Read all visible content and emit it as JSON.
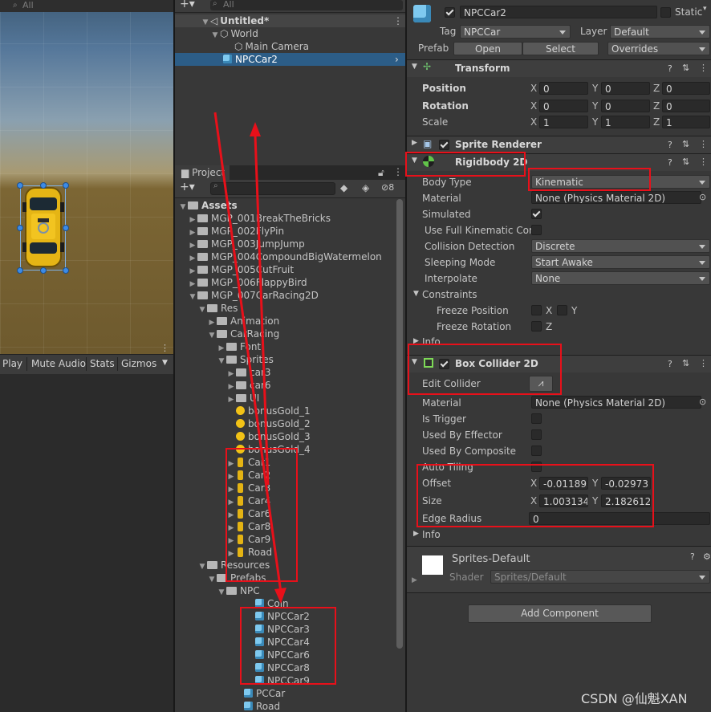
{
  "scene": {
    "search_placeholder": "All"
  },
  "game_toolbar": {
    "play": "Play",
    "mute_audio": "Mute Audio",
    "stats": "Stats",
    "gizmos": "Gizmos"
  },
  "hierarchy": {
    "search_placeholder": "All",
    "items": [
      {
        "label": "Untitled*"
      },
      {
        "label": "World"
      },
      {
        "label": "Main Camera"
      },
      {
        "label": "NPCCar2"
      }
    ]
  },
  "project": {
    "tab": "Project",
    "hidden_count": "8",
    "tree": [
      {
        "label": "Assets"
      },
      {
        "label": "MGP_001BreakTheBricks"
      },
      {
        "label": "MGP_002FlyPin"
      },
      {
        "label": "MGP_003JumpJump"
      },
      {
        "label": "MGP_004CompoundBigWatermelon"
      },
      {
        "label": "MGP_005CutFruit"
      },
      {
        "label": "MGP_006FlappyBird"
      },
      {
        "label": "MGP_007CarRacing2D"
      },
      {
        "label": "Res"
      },
      {
        "label": "Animation"
      },
      {
        "label": "CarRacing"
      },
      {
        "label": "Font"
      },
      {
        "label": "Sprites"
      },
      {
        "label": "car3"
      },
      {
        "label": "car6"
      },
      {
        "label": "UI"
      },
      {
        "label": "bonusGold_1"
      },
      {
        "label": "bonusGold_2"
      },
      {
        "label": "bonusGold_3"
      },
      {
        "label": "bonusGold_4"
      },
      {
        "label": "Car1"
      },
      {
        "label": "Car2"
      },
      {
        "label": "Car3"
      },
      {
        "label": "Car4"
      },
      {
        "label": "Car6"
      },
      {
        "label": "Car8"
      },
      {
        "label": "Car9"
      },
      {
        "label": "Road"
      },
      {
        "label": "Resources"
      },
      {
        "label": "Prefabs"
      },
      {
        "label": "NPC"
      },
      {
        "label": "Coin"
      },
      {
        "label": "NPCCar2"
      },
      {
        "label": "NPCCar3"
      },
      {
        "label": "NPCCar4"
      },
      {
        "label": "NPCCar6"
      },
      {
        "label": "NPCCar8"
      },
      {
        "label": "NPCCar9"
      },
      {
        "label": "PCCar"
      },
      {
        "label": "Road"
      }
    ]
  },
  "inspector": {
    "object_name": "NPCCar2",
    "static_label": "Static",
    "tag_label": "Tag",
    "tag_value": "NPCCar",
    "layer_label": "Layer",
    "layer_value": "Default",
    "prefab_label": "Prefab",
    "open": "Open",
    "select": "Select",
    "overrides": "Overrides",
    "transform": {
      "title": "Transform",
      "position_label": "Position",
      "rotation_label": "Rotation",
      "scale_label": "Scale",
      "x": "X",
      "y": "Y",
      "z": "Z",
      "position": [
        "0",
        "0",
        "0"
      ],
      "rotation": [
        "0",
        "0",
        "0"
      ],
      "scale": [
        "1",
        "1",
        "1"
      ]
    },
    "sprite_renderer": {
      "title": "Sprite Renderer"
    },
    "rigidbody": {
      "title": "Rigidbody 2D",
      "body_type_label": "Body Type",
      "body_type": "Kinematic",
      "material_label": "Material",
      "material": "None (Physics Material 2D)",
      "simulated_label": "Simulated",
      "full_kinematic_label": "Use Full Kinematic Cont",
      "collision_label": "Collision Detection",
      "collision": "Discrete",
      "sleeping_label": "Sleeping Mode",
      "sleeping": "Start Awake",
      "interpolate_label": "Interpolate",
      "interpolate": "None",
      "constraints_label": "Constraints",
      "freeze_position_label": "Freeze Position",
      "freeze_rotation_label": "Freeze Rotation",
      "x": "X",
      "y": "Y",
      "z": "Z",
      "info": "Info"
    },
    "box_collider": {
      "title": "Box Collider 2D",
      "edit_collider": "Edit Collider",
      "material_label": "Material",
      "material": "None (Physics Material 2D)",
      "is_trigger": "Is Trigger",
      "used_by_effector": "Used By Effector",
      "used_by_composite": "Used By Composite",
      "auto_tiling": "Auto Tiling",
      "offset_label": "Offset",
      "offset_x": "-0.011895",
      "offset_y": "-0.02973",
      "size_label": "Size",
      "size_x": "1.003134",
      "size_y": "2.182612",
      "edge_radius_label": "Edge Radius",
      "edge_radius": "0",
      "x": "X",
      "y": "Y",
      "info": "Info"
    },
    "material_preview": {
      "name": "Sprites-Default",
      "shader_label": "Shader",
      "shader": "Sprites/Default"
    },
    "add_component": "Add Component"
  },
  "watermark": "CSDN @仙魁XAN",
  "colors": {
    "annotation_red": "#e8101a",
    "selection_blue": "#2c5d87",
    "prefab_cube": "#7ec9ef"
  }
}
